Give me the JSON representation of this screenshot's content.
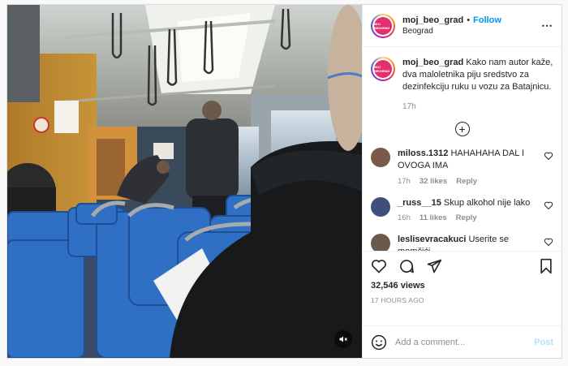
{
  "post": {
    "username": "moj_beo_grad",
    "avatar_text": "MOJ BEOGRAD",
    "follow_label": "Follow",
    "separator": "•",
    "location": "Beograd",
    "more_icon": "more-horizontal-icon",
    "caption": "Kako nam autor kaže, dva maloletnika piju sredstvo za dezinfekciju ruku u vozu za Batajnicu.",
    "caption_time": "17h",
    "views": "32,546 views",
    "posted_ago": "17 HOURS AGO"
  },
  "comments": [
    {
      "username": "miloss.1312",
      "text": "HAHAHAHA DAL I OVOGA IMA",
      "time": "17h",
      "likes": "32 likes",
      "reply": "Reply",
      "avatar_color": "#7a5a48"
    },
    {
      "username": "_russ__15",
      "text": "Skup alkohol nije lako",
      "time": "16h",
      "likes": "11 likes",
      "reply": "Reply",
      "avatar_color": "#3d4f7a"
    },
    {
      "username": "leslisevracakuci",
      "text": "Userite se momčići",
      "avatar_color": "#6b5a4a"
    }
  ],
  "composer": {
    "placeholder": "Add a comment...",
    "post_label": "Post"
  },
  "colors": {
    "accent": "#0095f6",
    "post_disabled": "#b2dffc",
    "seat_blue": "#2f6fc4"
  }
}
